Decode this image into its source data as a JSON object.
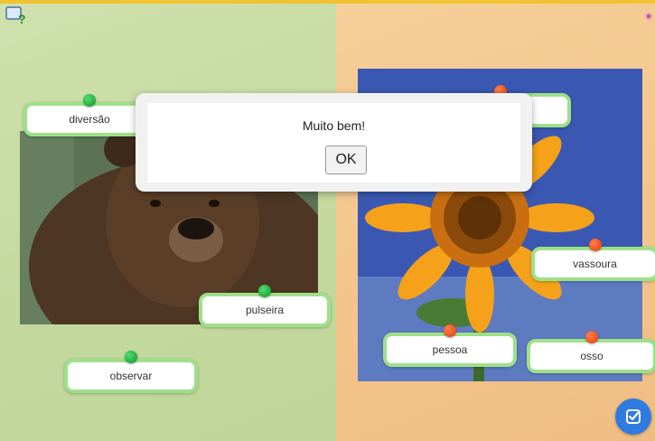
{
  "dialog": {
    "message": "Muito bem!",
    "ok_label": "OK"
  },
  "cards": {
    "diversao": "diversão",
    "pulseira": "pulseira",
    "observar": "observar",
    "vassoura": "vassoura",
    "pessoa": "pessoa",
    "osso": "osso"
  },
  "colors": {
    "left_panel": "#c4d99e",
    "right_panel": "#f3c48b",
    "pin_green": "#1fb544",
    "pin_red": "#f2501c",
    "card_border": "#9ee089",
    "check_button": "#2f7be0"
  },
  "icons": {
    "help": "help-question-icon",
    "check": "check-icon",
    "corner": "puzzle-icon"
  }
}
